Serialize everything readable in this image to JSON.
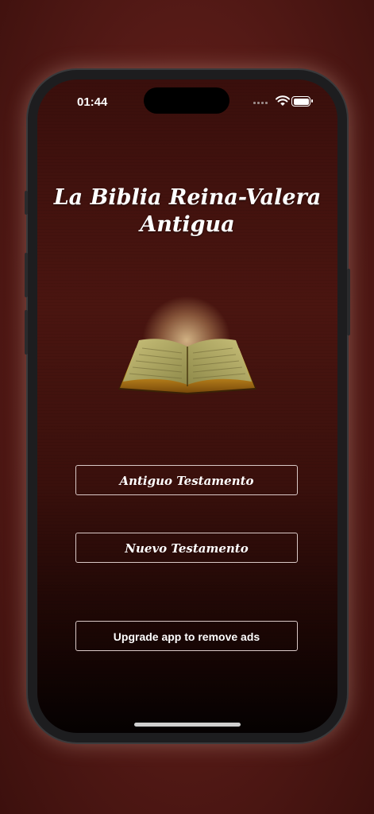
{
  "status_bar": {
    "time": "01:44",
    "icons": [
      "signal-icon",
      "wifi-icon",
      "battery-icon"
    ]
  },
  "app": {
    "title": "La Biblia Reina-Valera Antigua",
    "book_icon": "open-bible-icon"
  },
  "buttons": {
    "old_testament": "Antiguo Testamento",
    "new_testament": "Nuevo Testamento",
    "upgrade": "Upgrade app to remove ads"
  },
  "colors": {
    "background": "#4a1510",
    "button_border": "#d9c8c6",
    "text": "#ffffff"
  }
}
